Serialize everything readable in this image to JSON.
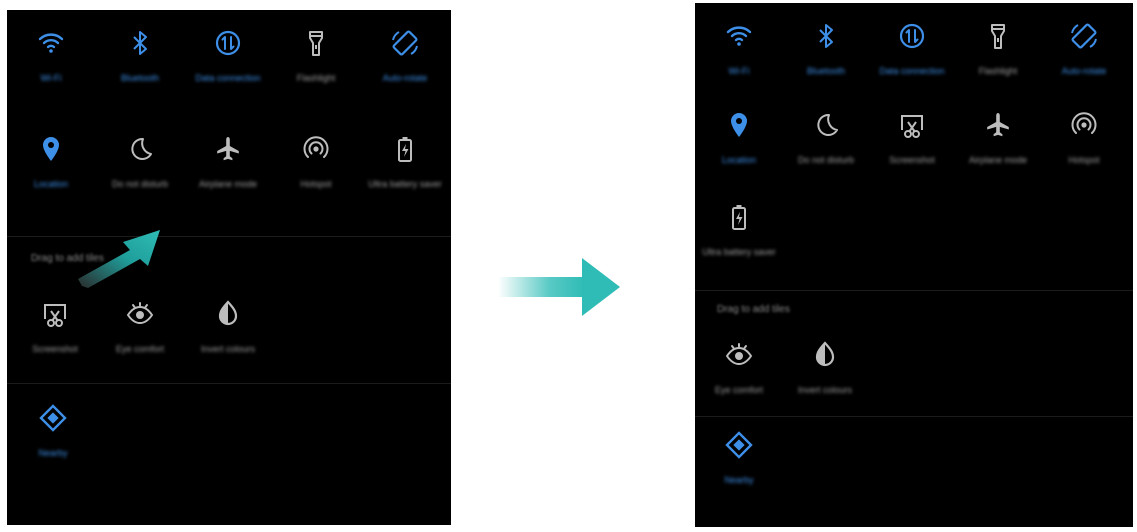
{
  "colors": {
    "accent": "#3d8fe8",
    "inactive": "#bdbdbd",
    "arrow": "#2fbcb6",
    "panel_bg": "#000000"
  },
  "before": {
    "active_tiles": [
      {
        "label": "Wi-Fi",
        "icon": "wifi-icon",
        "on": true
      },
      {
        "label": "Bluetooth",
        "icon": "bluetooth-icon",
        "on": true
      },
      {
        "label": "Data connection",
        "icon": "data-connection-icon",
        "on": true
      },
      {
        "label": "Flashlight",
        "icon": "flashlight-icon",
        "on": false
      },
      {
        "label": "Auto-rotate",
        "icon": "auto-rotate-icon",
        "on": true
      },
      {
        "label": "Location",
        "icon": "location-icon",
        "on": true
      },
      {
        "label": "Do not disturb",
        "icon": "moon-icon",
        "on": false
      },
      {
        "label": "Airplane mode",
        "icon": "airplane-icon",
        "on": false
      },
      {
        "label": "Hotspot",
        "icon": "hotspot-icon",
        "on": false
      },
      {
        "label": "Ultra battery saver",
        "icon": "battery-saver-icon",
        "on": false
      }
    ],
    "section_label": "Drag to add tiles",
    "hidden_tiles": [
      {
        "label": "Screenshot",
        "icon": "screenshot-icon",
        "on": false
      },
      {
        "label": "Eye comfort",
        "icon": "eye-icon",
        "on": false
      },
      {
        "label": "Invert colours",
        "icon": "invert-colors-icon",
        "on": false
      }
    ],
    "extra_tiles": [
      {
        "label": "Nearby",
        "icon": "nearby-icon",
        "on": true
      }
    ]
  },
  "after": {
    "active_tiles": [
      {
        "label": "Wi-Fi",
        "icon": "wifi-icon",
        "on": true
      },
      {
        "label": "Bluetooth",
        "icon": "bluetooth-icon",
        "on": true
      },
      {
        "label": "Data connection",
        "icon": "data-connection-icon",
        "on": true
      },
      {
        "label": "Flashlight",
        "icon": "flashlight-icon",
        "on": false
      },
      {
        "label": "Auto-rotate",
        "icon": "auto-rotate-icon",
        "on": true
      },
      {
        "label": "Location",
        "icon": "location-icon",
        "on": true
      },
      {
        "label": "Do not disturb",
        "icon": "moon-icon",
        "on": false
      },
      {
        "label": "Screenshot",
        "icon": "screenshot-icon",
        "on": false
      },
      {
        "label": "Airplane mode",
        "icon": "airplane-icon",
        "on": false
      },
      {
        "label": "Hotspot",
        "icon": "hotspot-icon",
        "on": false
      },
      {
        "label": "Ultra battery saver",
        "icon": "battery-saver-icon",
        "on": false
      }
    ],
    "section_label": "Drag to add tiles",
    "hidden_tiles": [
      {
        "label": "Eye comfort",
        "icon": "eye-icon",
        "on": false
      },
      {
        "label": "Invert colours",
        "icon": "invert-colors-icon",
        "on": false
      }
    ],
    "extra_tiles": [
      {
        "label": "Nearby",
        "icon": "nearby-icon",
        "on": true
      }
    ]
  }
}
